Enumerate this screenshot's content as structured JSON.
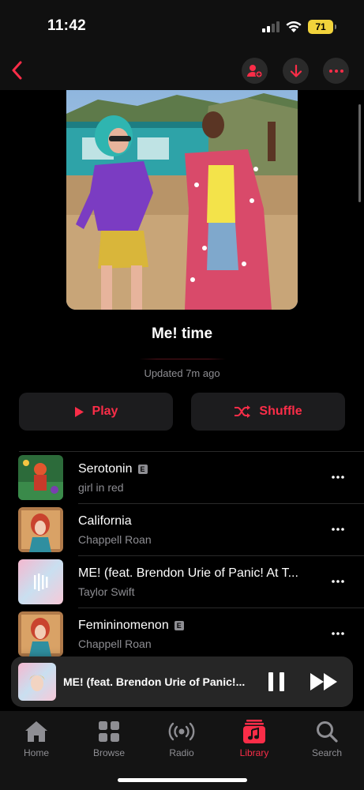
{
  "status_bar": {
    "time": "11:42",
    "battery": "71"
  },
  "playlist": {
    "title": "Me! time",
    "updated": "Updated 7m ago",
    "play_label": "Play",
    "shuffle_label": "Shuffle"
  },
  "tracks": [
    {
      "title": "Serotonin",
      "explicit": "E",
      "artist": "girl in red"
    },
    {
      "title": "California",
      "artist": "Chappell Roan"
    },
    {
      "title": "ME! (feat. Brendon Urie of Panic! At T...",
      "artist": "Taylor Swift"
    },
    {
      "title": "Femininomenon",
      "explicit": "E",
      "artist": "Chappell Roan"
    }
  ],
  "mini_player": {
    "title": "ME! (feat. Brendon Urie of Panic!..."
  },
  "tabs": [
    {
      "label": "Home",
      "icon": "home-icon"
    },
    {
      "label": "Browse",
      "icon": "grid-icon"
    },
    {
      "label": "Radio",
      "icon": "radio-icon"
    },
    {
      "label": "Library",
      "icon": "music-note-icon"
    },
    {
      "label": "Search",
      "icon": "search-icon"
    }
  ],
  "colors": {
    "accent": "#fa2d48",
    "background": "#000000",
    "secondary_text": "#8e8e93",
    "battery": "#f2d33b"
  }
}
